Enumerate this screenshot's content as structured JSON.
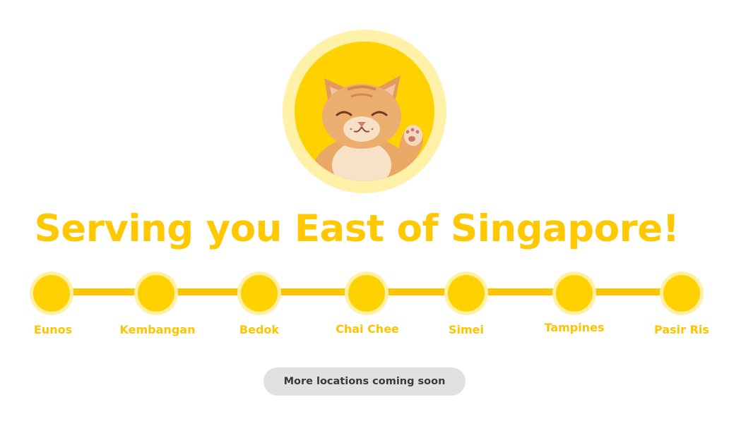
{
  "hero": {
    "image_subject": "smiling-waving-cat",
    "ring_color": "#FFF1A8",
    "disc_color": "#FFD100"
  },
  "headline": "Serving you East of Singapore!",
  "route": {
    "line_color": "#FFC400",
    "stops": [
      {
        "label": "Eunos"
      },
      {
        "label": "Kembangan"
      },
      {
        "label": "Bedok"
      },
      {
        "label": "Chai Chee"
      },
      {
        "label": "Simei"
      },
      {
        "label": "Tampines"
      },
      {
        "label": "Pasir Ris"
      }
    ]
  },
  "cta": {
    "label": "More locations coming soon"
  }
}
